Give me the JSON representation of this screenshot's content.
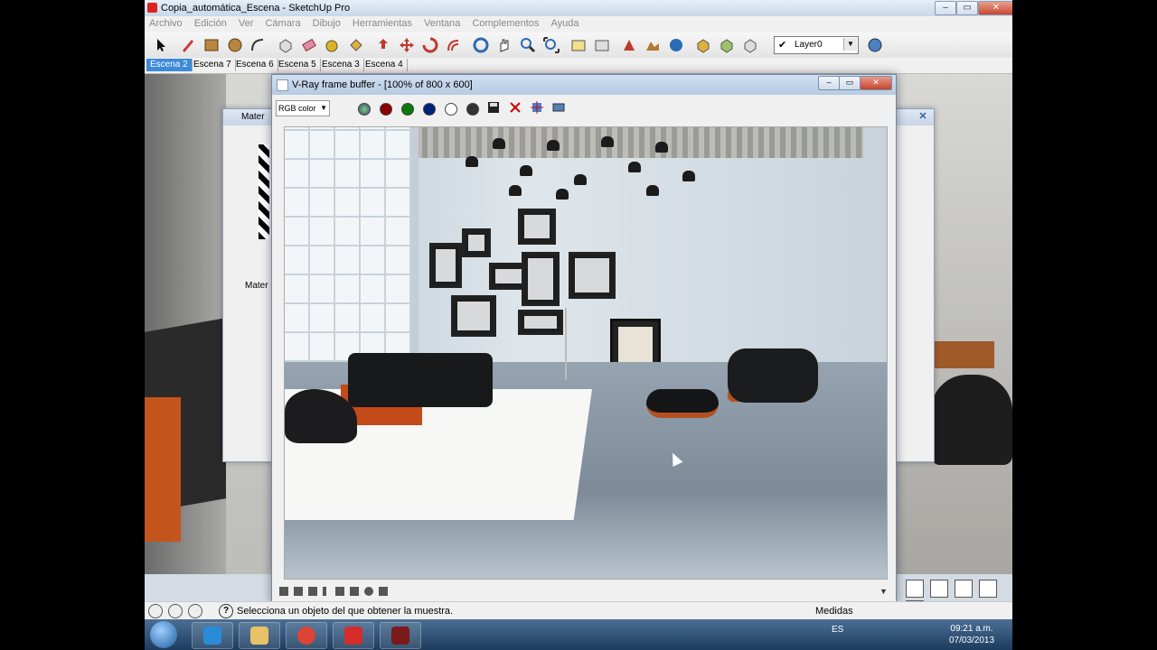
{
  "app": {
    "title": "Copia_automática_Escena - SketchUp Pro",
    "menu": [
      "Archivo",
      "Edición",
      "Ver",
      "Cámara",
      "Dibujo",
      "Herramientas",
      "Ventana",
      "Complementos",
      "Ayuda"
    ],
    "layer_value": "Layer0",
    "scenes": [
      "Escena 2",
      "Escena 7",
      "Escena 6",
      "Escena 5",
      "Escena 3",
      "Escena 4"
    ],
    "active_scene": "Escena 2"
  },
  "material_window": {
    "title": "Mater",
    "sub_label": "Mater"
  },
  "vray": {
    "title": "V-Ray frame buffer - [100% of 800 x 600]",
    "channel_select": "RGB color"
  },
  "status": {
    "message": "Selecciona un objeto del que obtener la muestra.",
    "measures_label": "Medidas"
  },
  "taskbar": {
    "language": "ES",
    "time": "09:21 a.m.",
    "date": "07/03/2013"
  },
  "colors": {
    "accent": "#3c8ad8",
    "close_red": "#c84530",
    "orange_leather": "#c44b1a"
  }
}
